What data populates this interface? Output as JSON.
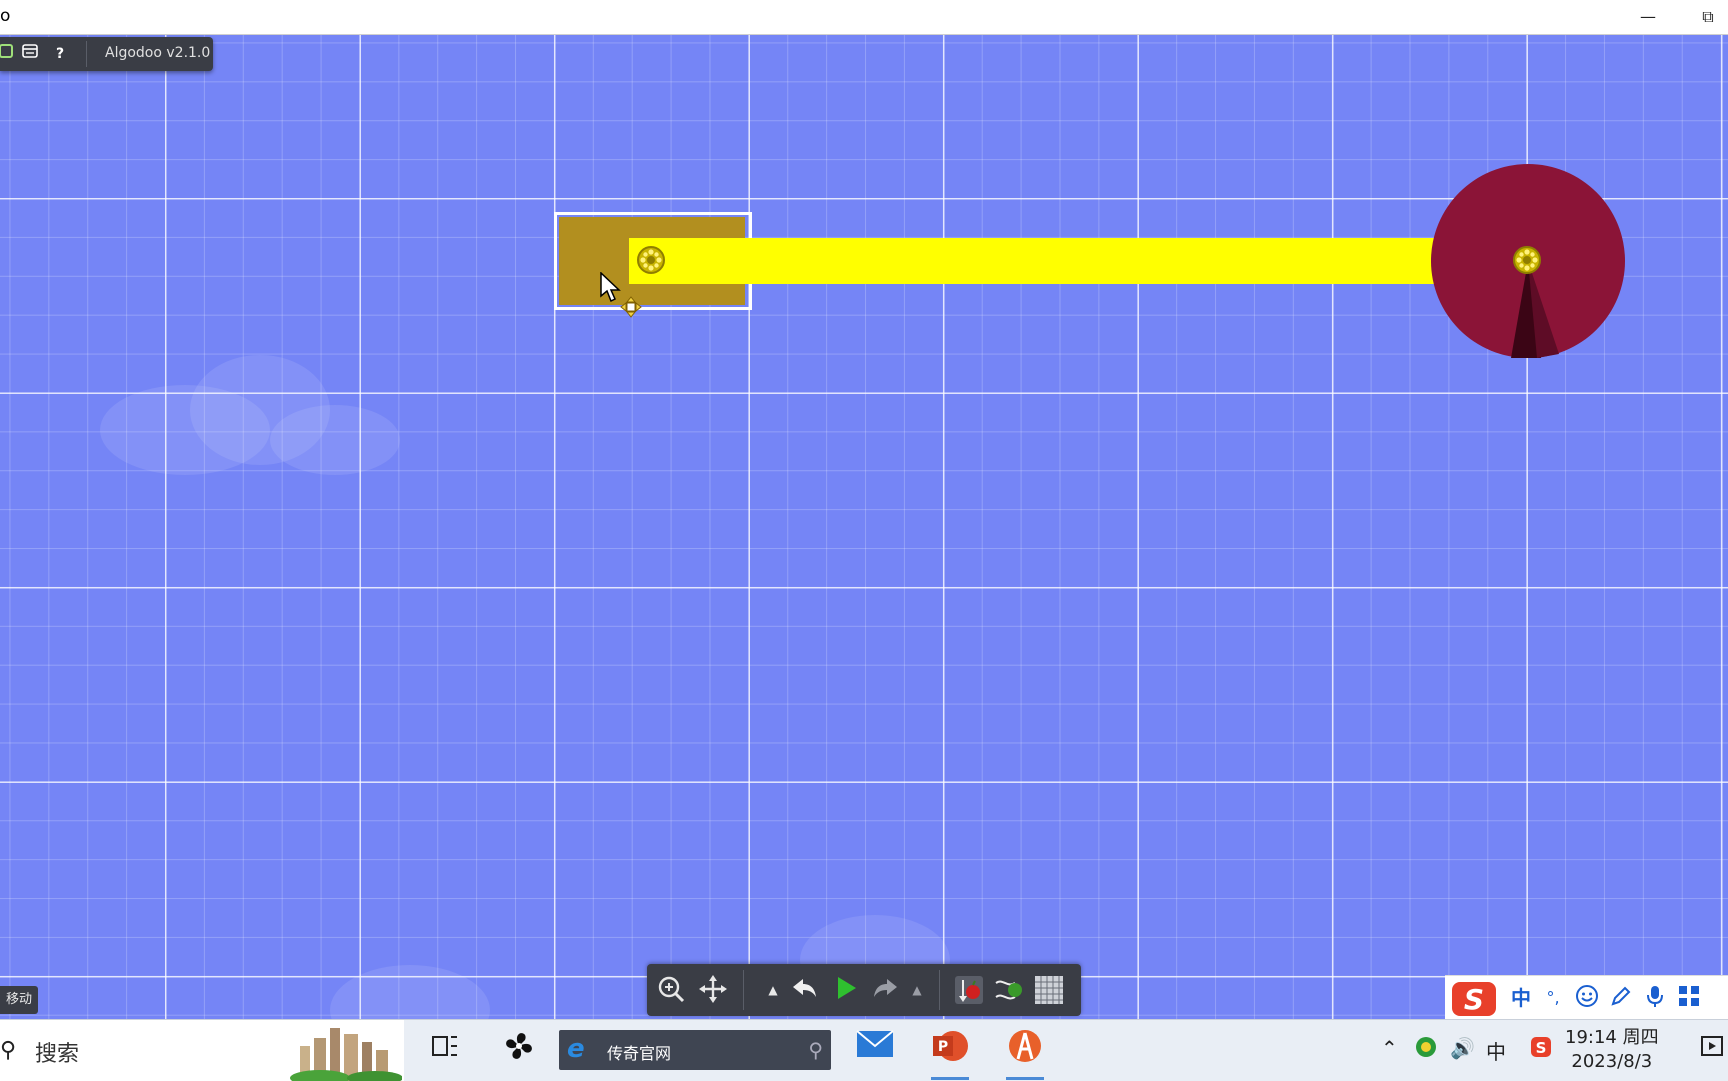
{
  "window": {
    "title": "o",
    "minimize_icon": "minimize-icon",
    "restore_icon": "restore-icon"
  },
  "top_toolbar": {
    "version_label": "Algodoo v2.1.0",
    "help_label": "?"
  },
  "scene": {
    "background_color": "#7585f6",
    "box_color": "#b28f1f",
    "bar_color": "#ffff00",
    "circle_color": "#8b1437"
  },
  "status": {
    "mode_label": "移动"
  },
  "bottom_toolbar": {
    "tools": [
      "zoom-tool",
      "move-tool",
      "undo-menu",
      "undo",
      "play",
      "redo",
      "redo-menu",
      "gravity-toggle",
      "air-friction-toggle",
      "grid-toggle"
    ]
  },
  "ime": {
    "chinese_label": "中",
    "punct_label": "°,"
  },
  "taskbar": {
    "search_label": "搜索",
    "ie_label": "传奇官网",
    "tray_lang": "中",
    "time": "19:14 周四",
    "date": "2023/8/3"
  }
}
